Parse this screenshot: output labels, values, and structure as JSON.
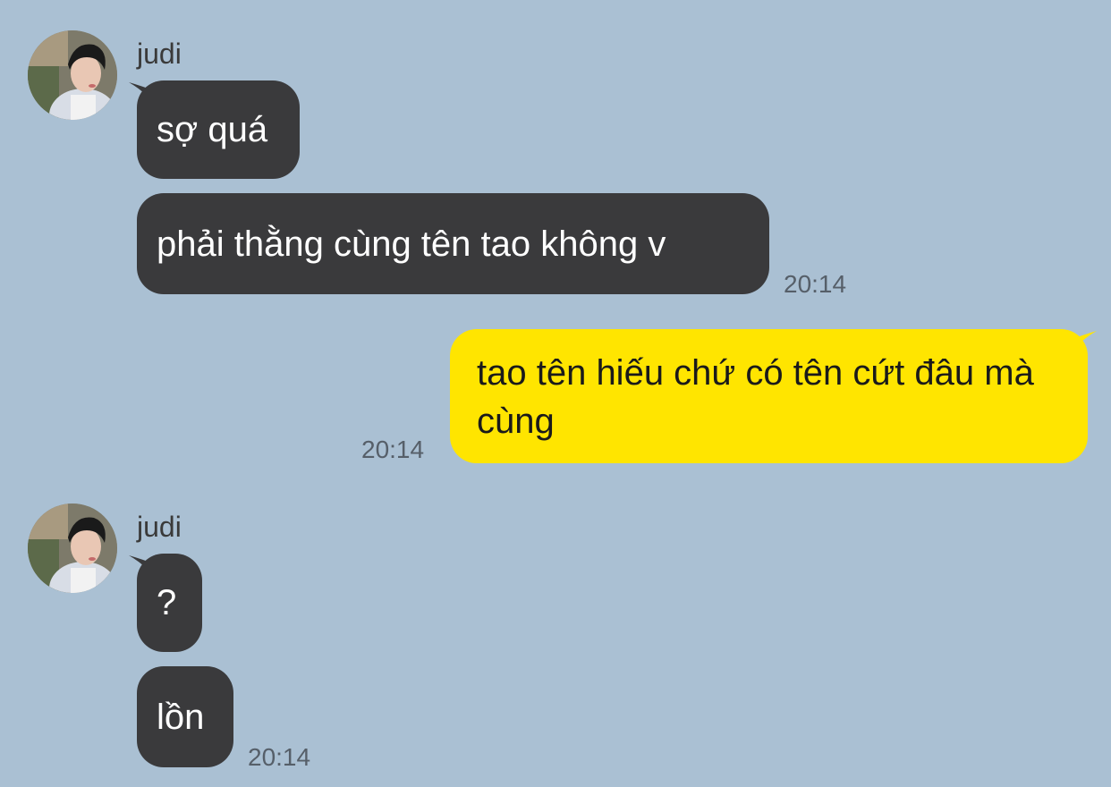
{
  "conversation": {
    "group1": {
      "sender": "judi",
      "messages": [
        {
          "text": "sợ quá"
        },
        {
          "text": "phải thằng cùng tên tao không v"
        }
      ],
      "time": "20:14"
    },
    "outgoing": {
      "text": "tao tên hiếu chứ có tên cứt đâu mà cùng",
      "time": "20:14"
    },
    "group2": {
      "sender": "judi",
      "messages": [
        {
          "text": "?"
        },
        {
          "text": "lồn"
        }
      ],
      "time": "20:14"
    }
  },
  "colors": {
    "background": "#aac0d3",
    "incoming_bubble": "#3a3a3c",
    "outgoing_bubble": "#ffe500",
    "timestamp": "#565f69"
  },
  "icons": {
    "avatar": "profile-photo"
  }
}
